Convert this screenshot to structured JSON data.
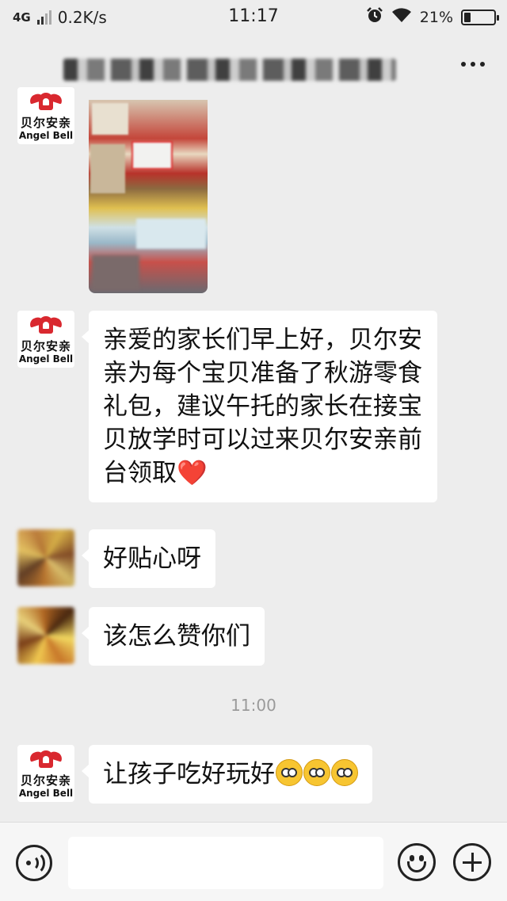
{
  "status_bar": {
    "network": "4G",
    "speed": "0.2K/s",
    "time": "11:17",
    "battery": "21%",
    "battery_level": 0.21,
    "icons": [
      "signal-icon",
      "alarm-icon",
      "wifi-icon",
      "battery-icon"
    ]
  },
  "header": {
    "title_blurred": true,
    "more_icon": "more-icon"
  },
  "brand_avatar": {
    "name_cn": "贝尔安亲",
    "name_en": "Angel Bell",
    "color": "#d9282f"
  },
  "messages": [
    {
      "type": "image",
      "sender": "brand"
    },
    {
      "type": "text",
      "sender": "brand",
      "text": "亲爱的家长们早上好，贝尔安亲为每个宝贝准备了秋游零食礼包，建议午托的家长在接宝贝放学时可以过来贝尔安亲前台领取",
      "emoji": "❤️"
    },
    {
      "type": "text",
      "sender": "parent-1",
      "text": "好贴心呀"
    },
    {
      "type": "text",
      "sender": "parent-2",
      "text": "该怎么赞你们"
    },
    {
      "type": "time",
      "text": "11:00"
    },
    {
      "type": "text",
      "sender": "brand",
      "text": "让孩子吃好玩好",
      "emoji_icons": [
        "cheer-emoji",
        "slap-forehead-emoji",
        "slap-forehead-emoji"
      ]
    }
  ],
  "input_bar": {
    "voice_icon": "voice-icon",
    "input_value": "",
    "emoji_icon": "smile-icon",
    "add_icon": "plus-icon"
  }
}
